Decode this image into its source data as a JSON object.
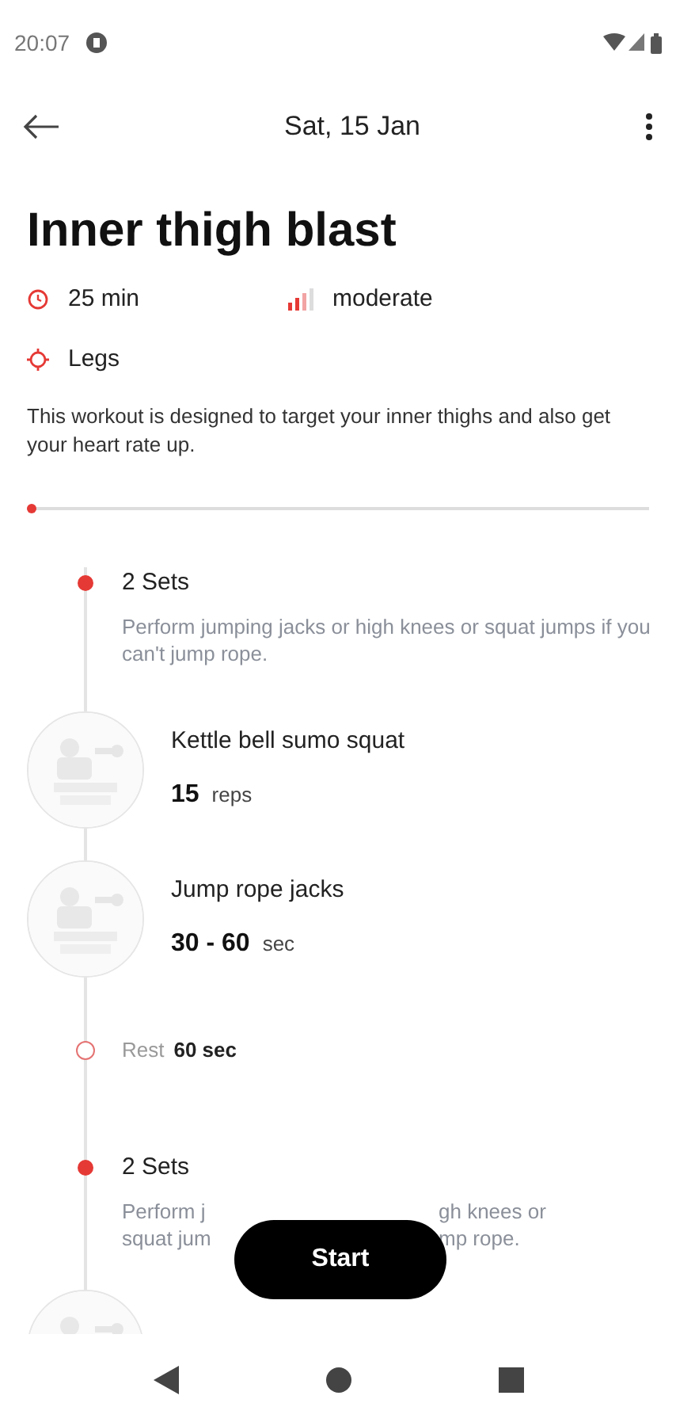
{
  "status_bar": {
    "time": "20:07"
  },
  "app_bar": {
    "title": "Sat, 15 Jan"
  },
  "workout": {
    "title": "Inner thigh blast",
    "description": "This workout is designed to target your inner thighs and also get your heart rate up."
  },
  "stats": [
    {
      "kind": "duration",
      "text": "25 min"
    },
    {
      "kind": "intensity",
      "text": "moderate"
    },
    {
      "kind": "body",
      "text": "Legs"
    }
  ],
  "progress": {
    "level": 0
  },
  "timeline": [
    {
      "kind": "set",
      "title": "2 Sets",
      "description": "Perform jumping jacks or high knees or squat jumps if you can't jump rope."
    },
    {
      "kind": "exercise",
      "name": "Kettle bell sumo squat",
      "amount": "15",
      "unit": "reps"
    },
    {
      "kind": "exercise",
      "name": "Jump rope jacks",
      "amount": "30 - 60",
      "unit": "sec"
    },
    {
      "kind": "rest",
      "label": "Rest",
      "amount": "60 sec"
    },
    {
      "kind": "set_covered",
      "title": "2 Sets",
      "left_lines": [
        "Perform j",
        "squat jum"
      ],
      "right_lines": [
        "gh knees or",
        "mp rope."
      ]
    },
    {
      "kind": "exercise_cut"
    }
  ],
  "start_button": {
    "label": "Start"
  }
}
